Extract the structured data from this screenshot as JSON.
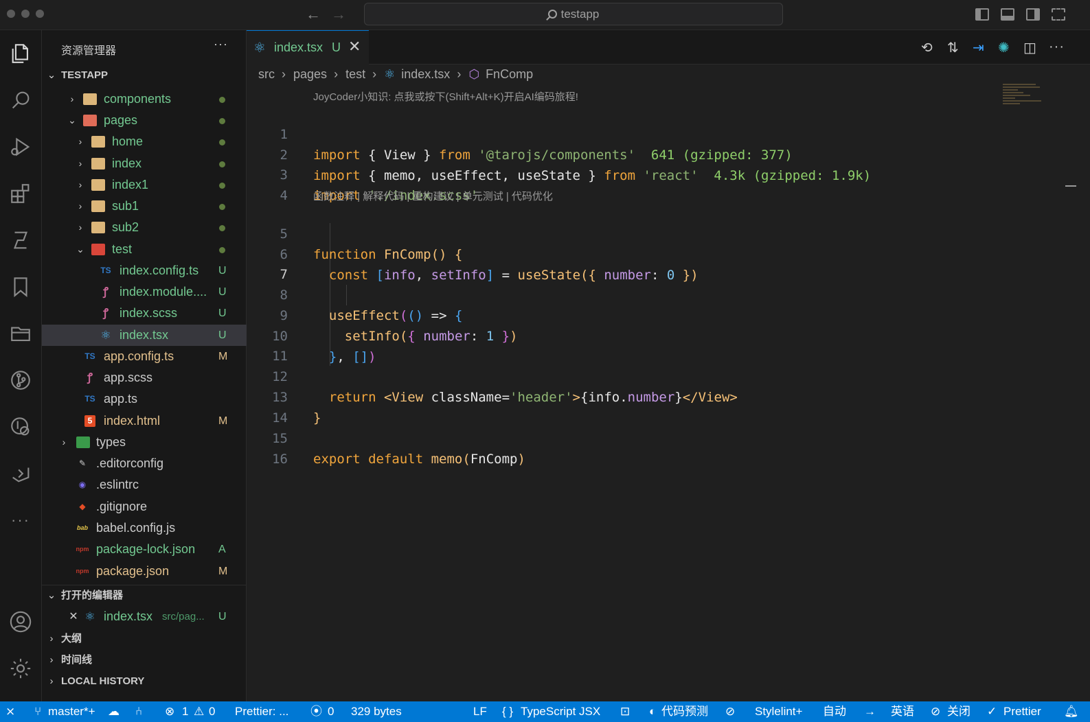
{
  "window": {
    "title": "testapp"
  },
  "sidebar": {
    "title": "资源管理器",
    "more": "···",
    "root": "TESTAPP",
    "tree": [
      {
        "label": "components",
        "status": "",
        "dot": true,
        "color": "green"
      },
      {
        "label": "pages",
        "status": "",
        "dot": true,
        "color": "green"
      },
      {
        "label": "home",
        "status": "",
        "dot": true,
        "color": "green"
      },
      {
        "label": "index",
        "status": "",
        "dot": true,
        "color": "green"
      },
      {
        "label": "index1",
        "status": "",
        "dot": true,
        "color": "green"
      },
      {
        "label": "sub1",
        "status": "",
        "dot": true,
        "color": "green"
      },
      {
        "label": "sub2",
        "status": "",
        "dot": true,
        "color": "green"
      },
      {
        "label": "test",
        "status": "",
        "dot": true,
        "color": "green"
      },
      {
        "label": "index.config.ts",
        "status": "U",
        "icon": "TS",
        "color": "green"
      },
      {
        "label": "index.module....",
        "status": "U",
        "color": "green"
      },
      {
        "label": "index.scss",
        "status": "U",
        "color": "green"
      },
      {
        "label": "index.tsx",
        "status": "U",
        "color": "green"
      },
      {
        "label": "app.config.ts",
        "status": "M",
        "icon": "TS",
        "color": "yellow"
      },
      {
        "label": "app.scss",
        "status": "",
        "color": "white"
      },
      {
        "label": "app.ts",
        "status": "",
        "icon": "TS",
        "color": "white"
      },
      {
        "label": "index.html",
        "status": "M",
        "color": "yellow"
      },
      {
        "label": "types",
        "status": "",
        "color": "white"
      },
      {
        "label": ".editorconfig",
        "status": "",
        "color": "white"
      },
      {
        "label": ".eslintrc",
        "status": "",
        "color": "white"
      },
      {
        "label": ".gitignore",
        "status": "",
        "color": "white"
      },
      {
        "label": "babel.config.js",
        "status": "",
        "color": "white"
      },
      {
        "label": "package-lock.json",
        "status": "A",
        "color": "green"
      },
      {
        "label": "package.json",
        "status": "M",
        "color": "yellow"
      }
    ],
    "open_editors": {
      "title": "打开的编辑器",
      "item_name": "index.tsx",
      "item_path": "src/pag...",
      "item_status": "U"
    },
    "outline": "大纲",
    "timeline": "时间线",
    "local_history": "LOCAL HISTORY"
  },
  "editor": {
    "tab": {
      "label": "index.tsx",
      "status": "U",
      "close": "✕"
    },
    "breadcrumb": [
      "src",
      "pages",
      "test",
      "index.tsx",
      "FnComp"
    ],
    "codelens_top": "JoyCoder小知识: 点我或按下(Shift+Alt+K)开启AI编码旅程!",
    "codelens_fn": "函数注释 | 解释代码 | 重构建议 | 单元测试 | 代码优化",
    "line_numbers": [
      "1",
      "2",
      "3",
      "4",
      "5",
      "6",
      "7",
      "8",
      "9",
      "10",
      "11",
      "12",
      "13",
      "14",
      "15",
      "16"
    ],
    "code": {
      "l1": {
        "kw": "import",
        "a": " { View } ",
        "from": "from",
        "str": " '@tarojs/components'",
        "hint": "  641 (gzipped: 377)"
      },
      "l2": {
        "kw": "import",
        "a": " { memo, useEffect, useState } ",
        "from": "from",
        "str": " 'react'",
        "hint": "  4.3k (gzipped: 1.9k)"
      },
      "l3": {
        "kw": "import",
        "str": " './index.scss'"
      },
      "l5": {
        "kw": "function",
        "fn": " FnComp",
        "rest": "() {"
      },
      "l6": {
        "kw": "const",
        "b1": " [",
        "v1": "info",
        "c": ", ",
        "v2": "setInfo",
        "b2": "]",
        "eq": " = ",
        "fn": "useState",
        "p1": "(",
        "b3": "{",
        "prop": " number",
        "colon": ": ",
        "num": "0",
        "b4": " }",
        "p2": ")"
      },
      "l8": {
        "fn": "useEffect",
        "p1": "(",
        "p2": "()",
        "arrow": " => ",
        "b": "{"
      },
      "l9": {
        "fn": "setInfo",
        "p1": "(",
        "b1": "{",
        "prop": " number",
        "colon": ": ",
        "num": "1",
        "b2": " }",
        "p2": ")"
      },
      "l10": {
        "b": "}",
        "c": ", ",
        "arr": "[]",
        "p": ")"
      },
      "l12": {
        "kw": "return",
        "tag1": " <View",
        "attr": " className",
        "eq": "=",
        "str": "'header'",
        "gt": ">",
        "e1": "{",
        "v": "info",
        "dot": ".",
        "prop": "number",
        "e2": "}",
        "tag2": "</View>"
      },
      "l13": {
        "b": "}"
      },
      "l15": {
        "kw1": "export",
        "kw2": " default",
        "fn": " memo",
        "p1": "(",
        "a": "FnComp",
        "p2": ")"
      }
    }
  },
  "statusbar": {
    "remote": "⨯",
    "branch": "master*+",
    "errors": "1",
    "warnings": "0",
    "prettier_short": "Prettier: ...",
    "ports": "0",
    "size": "329 bytes",
    "eol": "LF",
    "lang_brace": "{ }",
    "language": "TypeScript JSX",
    "prediction": "代码预测",
    "stylelint": "Stylelint+",
    "auto": "自动",
    "lang_cn": "英语",
    "close": "关闭",
    "prettier": "Prettier"
  },
  "colors": {
    "accent": "#0078d4",
    "untracked": "#73c991",
    "modified": "#e2c08d"
  }
}
